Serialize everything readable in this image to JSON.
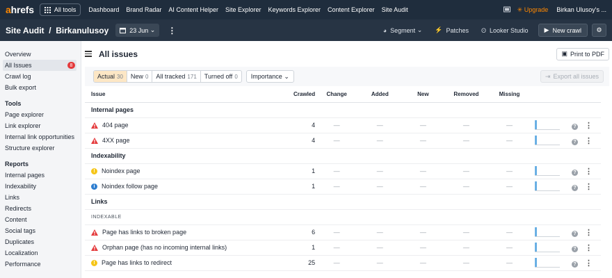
{
  "topbar": {
    "logo_a": "a",
    "logo_rest": "hrefs",
    "all_tools": "All tools",
    "nav": [
      "Dashboard",
      "Brand Radar",
      "AI Content Helper",
      "Site Explorer",
      "Keywords Explorer",
      "Content Explorer",
      "Site Audit"
    ],
    "upgrade": "Upgrade",
    "user": "Birkan Ulusoy's ..."
  },
  "subbar": {
    "title": "Site Audit  /  Birkanulusoy",
    "date": "23 Jun",
    "segment": "Segment",
    "patches": "Patches",
    "looker": "Looker Studio",
    "new_crawl": "New crawl"
  },
  "sidebar": {
    "top": [
      {
        "label": "Overview"
      },
      {
        "label": "All Issues",
        "badge": "8",
        "selected": true
      },
      {
        "label": "Crawl log"
      },
      {
        "label": "Bulk export"
      }
    ],
    "tools_header": "Tools",
    "tools": [
      "Page explorer",
      "Link explorer",
      "Internal link opportunities",
      "Structure explorer"
    ],
    "reports_header": "Reports",
    "reports": [
      "Internal pages",
      "Indexability",
      "Links",
      "Redirects",
      "Content",
      "Social tags",
      "Duplicates",
      "Localization",
      "Performance"
    ]
  },
  "main": {
    "title": "All issues",
    "print_pdf": "Print to PDF",
    "filters": [
      {
        "label": "Actual",
        "count": "30",
        "active": true
      },
      {
        "label": "New",
        "count": "0"
      },
      {
        "label": "All tracked",
        "count": "171"
      },
      {
        "label": "Turned off",
        "count": "0"
      }
    ],
    "importance": "Importance",
    "export_all": "Export all issues",
    "columns": [
      "Issue",
      "Crawled",
      "Change",
      "Added",
      "New",
      "Removed",
      "Missing"
    ],
    "dash": "—",
    "groups": [
      {
        "title": "Internal pages",
        "rows": [
          {
            "icon": "error",
            "name": "404 page",
            "crawled": "4"
          },
          {
            "icon": "error",
            "name": "4XX page",
            "crawled": "4"
          }
        ]
      },
      {
        "title": "Indexability",
        "rows": [
          {
            "icon": "warning",
            "name": "Noindex page",
            "crawled": "1"
          },
          {
            "icon": "notice",
            "name": "Noindex follow page",
            "crawled": "1"
          }
        ]
      },
      {
        "title": "Links",
        "subheader": "INDEXABLE",
        "rows": [
          {
            "icon": "error",
            "name": "Page has links to broken page",
            "crawled": "6"
          },
          {
            "icon": "error",
            "name": "Orphan page (has no incoming internal links)",
            "crawled": "1"
          },
          {
            "icon": "warning",
            "name": "Page has links to redirect",
            "crawled": "25"
          }
        ]
      }
    ]
  },
  "colors": {
    "error": "#e4393b",
    "warning": "#f5c518",
    "notice": "#2f7fd0",
    "accent": "#ff8800"
  }
}
